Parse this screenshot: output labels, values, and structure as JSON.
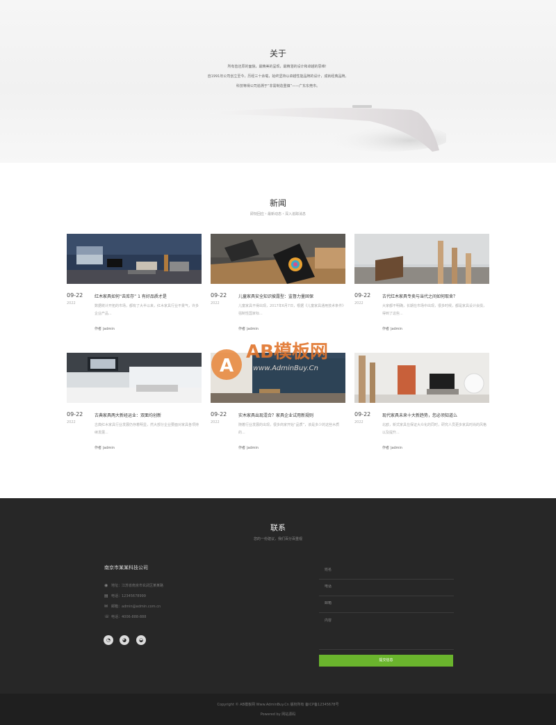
{
  "about": {
    "title": "关于",
    "lines": [
      "所有皆还原的面貌，最精美的呈现，最精湛的设计和卓越的思维！",
      "自1991年公司创立至今，历经三十余载，始终坚持以卓越性能品牌的设计，成就经典品牌。",
      "科技等得公司追溯于“非需制造重镇”——广东东莞市。"
    ]
  },
  "news": {
    "title": "新闻",
    "subtitle": "即刻回应・最新动态・深入追踪消息",
    "items": [
      {
        "date": "09-22",
        "year": "2022",
        "title": "红木家具如何“去库存” 1 有好品质才是",
        "desc": "数据统计开拓的市场，都有了大半以来，红木家具行业不景气，许多企业产品...",
        "author": "作者 |admin"
      },
      {
        "date": "09-22",
        "year": "2022",
        "title": "儿童家具安全知识披露型：监督力量固保",
        "desc": "儿童家具不得出现，2017年6月7日，根据《儿童家具通用技术条件》强制性国家标...",
        "author": "作者 |admin"
      },
      {
        "date": "09-22",
        "year": "2022",
        "title": "古代红木家具专卖与当代之间如何取舍？",
        "desc": "大家都不明确，长期在市场中出现，很多时候，都是家具设计会损，得到了这些...",
        "author": "作者 |admin"
      },
      {
        "date": "09-22",
        "year": "2022",
        "title": "古典家具两大新经运业：双面均创新",
        "desc": "古典红木家具行业发展仍存着明显，然大部分企业要面对家具各项持续发展...",
        "author": "作者 |admin"
      },
      {
        "date": "09-22",
        "year": "2022",
        "title": "实木家具出现混合？家具企业试用新规则",
        "desc": "随着行业发展的出现，很多商家开始“品质”，该是多少的这些木质的...",
        "author": "作者 |admin"
      },
      {
        "date": "09-22",
        "year": "2022",
        "title": "现代家具未来十大新趋势，您必须知道么",
        "desc": "北欧，新式家具在保证大众化的同时，研究人员更多家具时尚的风格以及提升...",
        "author": "作者 |admin"
      }
    ]
  },
  "watermark": {
    "brand": "AB模板网",
    "url": "www.AdminBuy.Cn"
  },
  "contact": {
    "title": "联系",
    "subtitle": "您的一份建议，我们百分百重视",
    "company": "南京市某某科技公司",
    "info": [
      {
        "icon": "location-icon",
        "glyph": "◉",
        "text": "地址：江苏省南京市玄武区某某路"
      },
      {
        "icon": "printer-icon",
        "glyph": "▤",
        "text": "电话：12345678999"
      },
      {
        "icon": "mail-icon",
        "glyph": "✉",
        "text": "邮箱：admin@admin.com.cn"
      },
      {
        "icon": "phone-icon",
        "glyph": "☏",
        "text": "电话：4006-888-888"
      }
    ],
    "social": [
      {
        "name": "qq-icon",
        "glyph": "◔"
      },
      {
        "name": "weibo-icon",
        "glyph": "◕"
      },
      {
        "name": "wechat-icon",
        "glyph": "◒"
      }
    ],
    "form": {
      "name_placeholder": "姓名",
      "phone_placeholder": "电话",
      "email_placeholder": "邮箱",
      "message_placeholder": "内容",
      "submit_label": "提交信息"
    }
  },
  "footer": {
    "copyright": "Copyright © AB模板网 Www.AdminBuy.Cn 版权所有  备ICP备12345678号",
    "powered": "Powered by 网站源码"
  },
  "colors": {
    "accent": "#6ab42d",
    "footer_bg": "#272727",
    "bottom_bg": "#1f1f1f"
  }
}
